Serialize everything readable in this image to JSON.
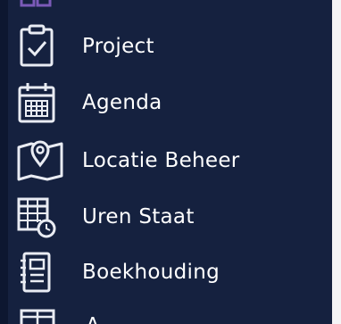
{
  "theme": {
    "background": "#15213f",
    "edge": "#0d1730",
    "icon_stroke": "#e9ecf3",
    "accent": "#7b5ab8"
  },
  "menu": {
    "items": [
      {
        "label": "Project",
        "icon": "clipboard-check-icon"
      },
      {
        "label": "Agenda",
        "icon": "calendar-icon"
      },
      {
        "label": "Locatie Beheer",
        "icon": "map-pin-icon"
      },
      {
        "label": "Uren Staat",
        "icon": "timesheet-clock-icon"
      },
      {
        "label": "Boekhouding",
        "icon": "ledger-book-icon"
      }
    ],
    "partial_bottom_label": "A"
  }
}
